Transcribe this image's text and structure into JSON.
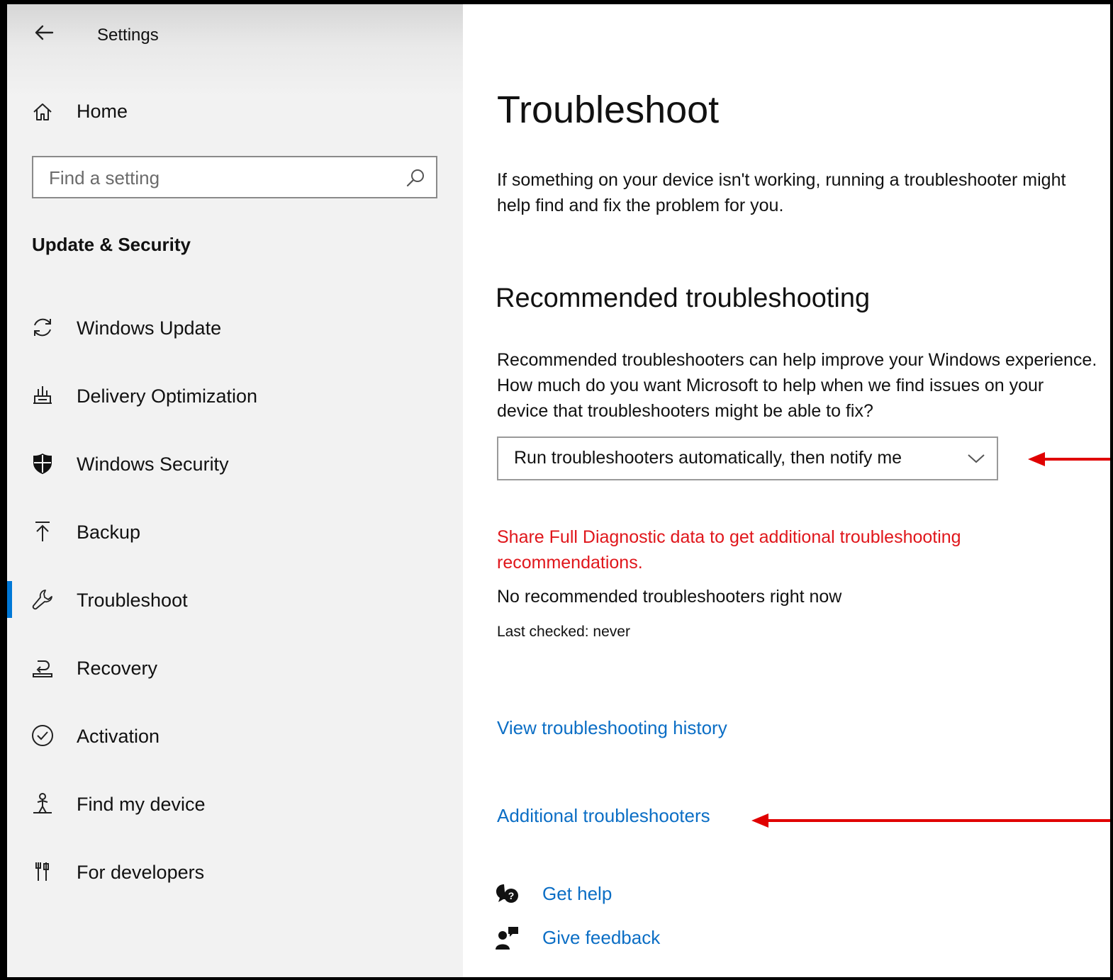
{
  "window": {
    "title": "Settings"
  },
  "sidebar": {
    "home_label": "Home",
    "search": {
      "placeholder": "Find a setting",
      "value": ""
    },
    "section_title": "Update & Security",
    "items": [
      {
        "label": "Windows Update",
        "icon": "refresh-icon"
      },
      {
        "label": "Delivery Optimization",
        "icon": "delivery-optimization-icon"
      },
      {
        "label": "Windows Security",
        "icon": "shield-icon"
      },
      {
        "label": "Backup",
        "icon": "upload-arrow-icon"
      },
      {
        "label": "Troubleshoot",
        "icon": "wrench-icon",
        "selected": true
      },
      {
        "label": "Recovery",
        "icon": "recovery-icon"
      },
      {
        "label": "Activation",
        "icon": "check-circle-icon"
      },
      {
        "label": "Find my device",
        "icon": "person-location-icon"
      },
      {
        "label": "For developers",
        "icon": "developer-tools-icon"
      }
    ]
  },
  "main": {
    "title": "Troubleshoot",
    "intro": "If something on your device isn't working, running a troubleshooter might help find and fix the problem for you.",
    "recommended": {
      "heading": "Recommended troubleshooting",
      "description": "Recommended troubleshooters can help improve your Windows experience. How much do you want Microsoft to help when we find issues on your device that troubleshooters might be able to fix?",
      "dropdown_value": "Run troubleshooters automatically, then notify me",
      "diagnostic_warning": "Share Full Diagnostic data to get additional troubleshooting recommendations.",
      "status": "No recommended troubleshooters right now",
      "last_checked": "Last checked: never"
    },
    "links": {
      "history": "View troubleshooting history",
      "additional": "Additional troubleshooters"
    },
    "help": {
      "get_help": "Get help",
      "give_feedback": "Give feedback"
    }
  },
  "colors": {
    "accent": "#0078d7",
    "link": "#0b6ec5",
    "warning": "#e0161b",
    "annotation_arrow": "#e00000",
    "sidebar_bg": "#f2f2f2"
  }
}
